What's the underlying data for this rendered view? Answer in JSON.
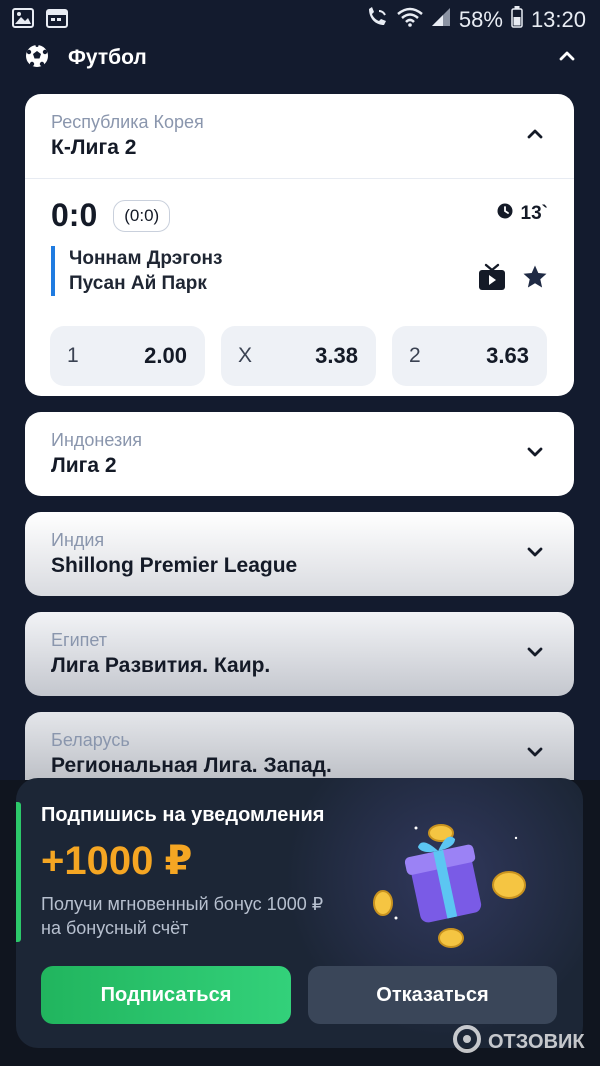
{
  "statusbar": {
    "battery_pct": "58%",
    "time": "13:20"
  },
  "sport": {
    "title": "Футбол"
  },
  "leagues": [
    {
      "country": "Республика Корея",
      "name": "К-Лига 2",
      "expanded": true
    },
    {
      "country": "Индонезия",
      "name": "Лига 2",
      "expanded": false
    },
    {
      "country": "Индия",
      "name": "Shillong Premier League",
      "expanded": false
    },
    {
      "country": "Египет",
      "name": "Лига Развития. Каир.",
      "expanded": false
    },
    {
      "country": "Беларусь",
      "name": "Региональная Лига. Запад.",
      "expanded": false
    }
  ],
  "match": {
    "score": "0:0",
    "halftime": "(0:0)",
    "minute": "13`",
    "team1": "Чоннам Дрэгонз",
    "team2": "Пусан Ай Парк",
    "odds": [
      {
        "label": "1",
        "value": "2.00"
      },
      {
        "label": "X",
        "value": "3.38"
      },
      {
        "label": "2",
        "value": "3.63"
      }
    ]
  },
  "promo": {
    "title": "Подпишись на уведомления",
    "amount": "+1000 ₽",
    "description": "Получи мгновенный бонус 1000 ₽ на бонусный счёт",
    "subscribe_label": "Подписаться",
    "decline_label": "Отказаться"
  },
  "watermark": "ОТЗОВИК",
  "colors": {
    "background": "#131b2e",
    "accent_green": "#2cc86a",
    "amount_orange": "#f5a623",
    "team_bar_blue": "#1f7be0"
  }
}
